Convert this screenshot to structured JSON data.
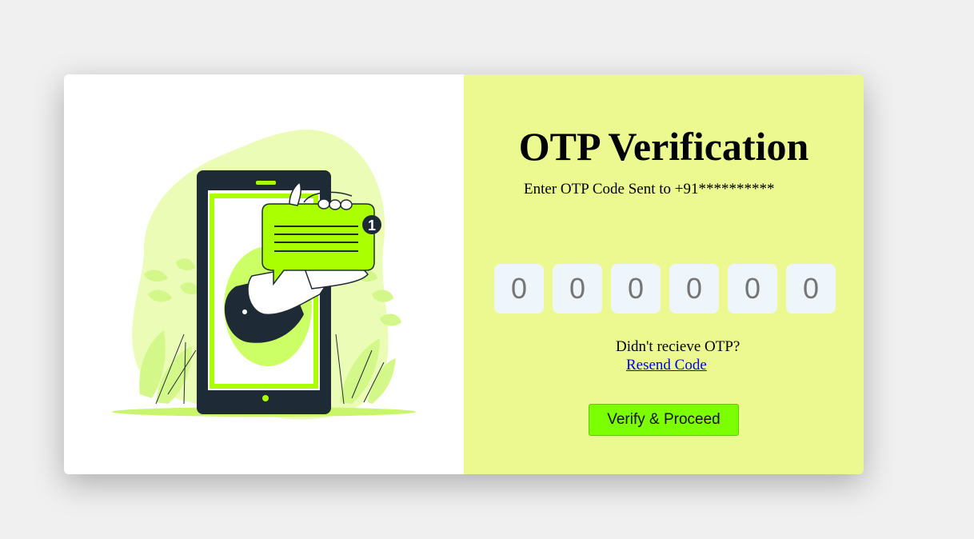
{
  "page": {
    "title": "OTP Verification",
    "subtitle": "Enter OTP Code Sent to +91**********"
  },
  "illustration": {
    "icon": "phone-otp-message-illustration",
    "notification_count": "1"
  },
  "otp": {
    "digits": [
      "0",
      "0",
      "0",
      "0",
      "0",
      "0"
    ]
  },
  "resend": {
    "prompt": "Didn't recieve OTP?",
    "link_label": "Resend Code"
  },
  "actions": {
    "verify_label": "Verify & Proceed"
  },
  "colors": {
    "page_background": "#f0f0f0",
    "panel_accent": "#ebf990",
    "button_green": "#7cff00",
    "illustration_green": "#aaff00",
    "link_blue": "#0000ee"
  }
}
